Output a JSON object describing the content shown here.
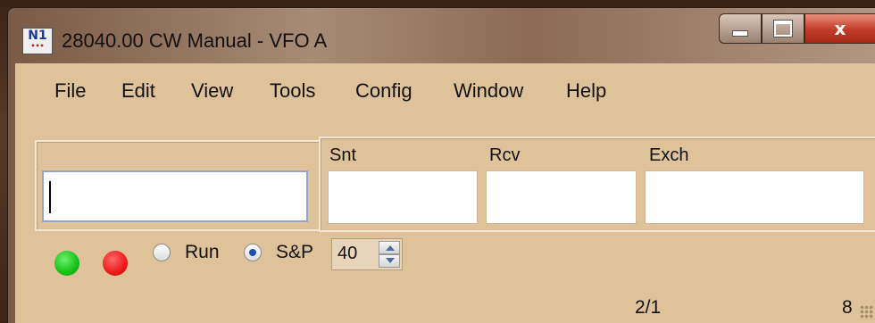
{
  "window": {
    "title": "28040.00 CW Manual - VFO A",
    "icon_text": "N1",
    "close_glyph": "x"
  },
  "menu": [
    "File",
    "Edit",
    "View",
    "Tools",
    "Config",
    "Window",
    "Help"
  ],
  "callsign": {
    "value": ""
  },
  "fields": {
    "snt_label": "Snt",
    "rcv_label": "Rcv",
    "exch_label": "Exch",
    "snt_value": "",
    "rcv_value": "",
    "exch_value": ""
  },
  "indicators": {
    "green_color": "#15c015",
    "red_color": "#f01818"
  },
  "mode": {
    "run_label": "Run",
    "sp_label": "S&P",
    "selected": "S&P"
  },
  "spinner": {
    "value": "40"
  },
  "status": {
    "qso_count": "2/1",
    "right_value": "8"
  },
  "icons": [
    "app-icon",
    "minimize-icon",
    "maximize-icon",
    "close-icon",
    "spin-up-icon",
    "spin-down-icon",
    "resize-grip-icon"
  ]
}
